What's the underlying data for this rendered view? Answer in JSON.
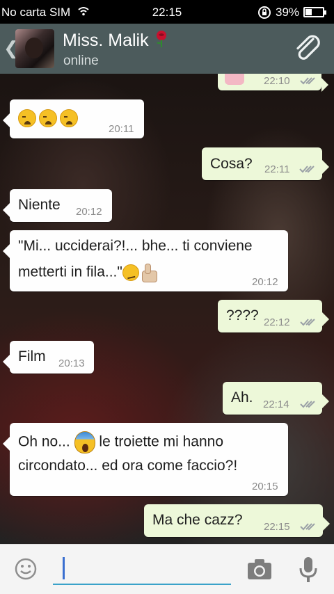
{
  "status_bar": {
    "carrier": "No carta SIM",
    "clock": "22:15",
    "battery_percent": "39%",
    "battery_level": 0.39
  },
  "header": {
    "contact_name": "Miss. Malik",
    "contact_emoji": "rose-icon",
    "status": "online",
    "back_icon": "chevron-left-icon",
    "attach_icon": "paperclip-icon"
  },
  "messages": [
    {
      "dir": "out",
      "text": "",
      "emoji": "girl-emoji-icon",
      "time": "22:10",
      "ticks": true
    },
    {
      "dir": "in",
      "text": "😩😩😩",
      "time": "20:11"
    },
    {
      "dir": "out",
      "text": "Cosa?",
      "time": "22:11",
      "ticks": true
    },
    {
      "dir": "in",
      "text": "Niente",
      "time": "20:12"
    },
    {
      "dir": "in",
      "line1": "\"Mi... ucciderai?!... bhe... ti conviene",
      "line2": "metterti in fila...\"",
      "time": "20:12"
    },
    {
      "dir": "out",
      "text": "????",
      "time": "22:12",
      "ticks": true
    },
    {
      "dir": "in",
      "text": "Film",
      "time": "20:13"
    },
    {
      "dir": "out",
      "text": "Ah.",
      "time": "22:14",
      "ticks": true
    },
    {
      "dir": "in",
      "line1a": "Oh no...",
      "line1b": "le troiette mi hanno",
      "line2": "circondato...  ed ora come faccio?!",
      "time": "20:15"
    },
    {
      "dir": "out",
      "text": "Ma che cazz?",
      "time": "22:15",
      "ticks": true
    }
  ],
  "input_bar": {
    "emoji_icon": "smiley-icon",
    "text": "",
    "camera_icon": "camera-icon",
    "mic_icon": "microphone-icon"
  },
  "colors": {
    "header": "#4c5b5c",
    "incoming_bubble": "#fefefe",
    "outgoing_bubble": "#edf8d9",
    "input_underline": "#3aa2c9"
  }
}
